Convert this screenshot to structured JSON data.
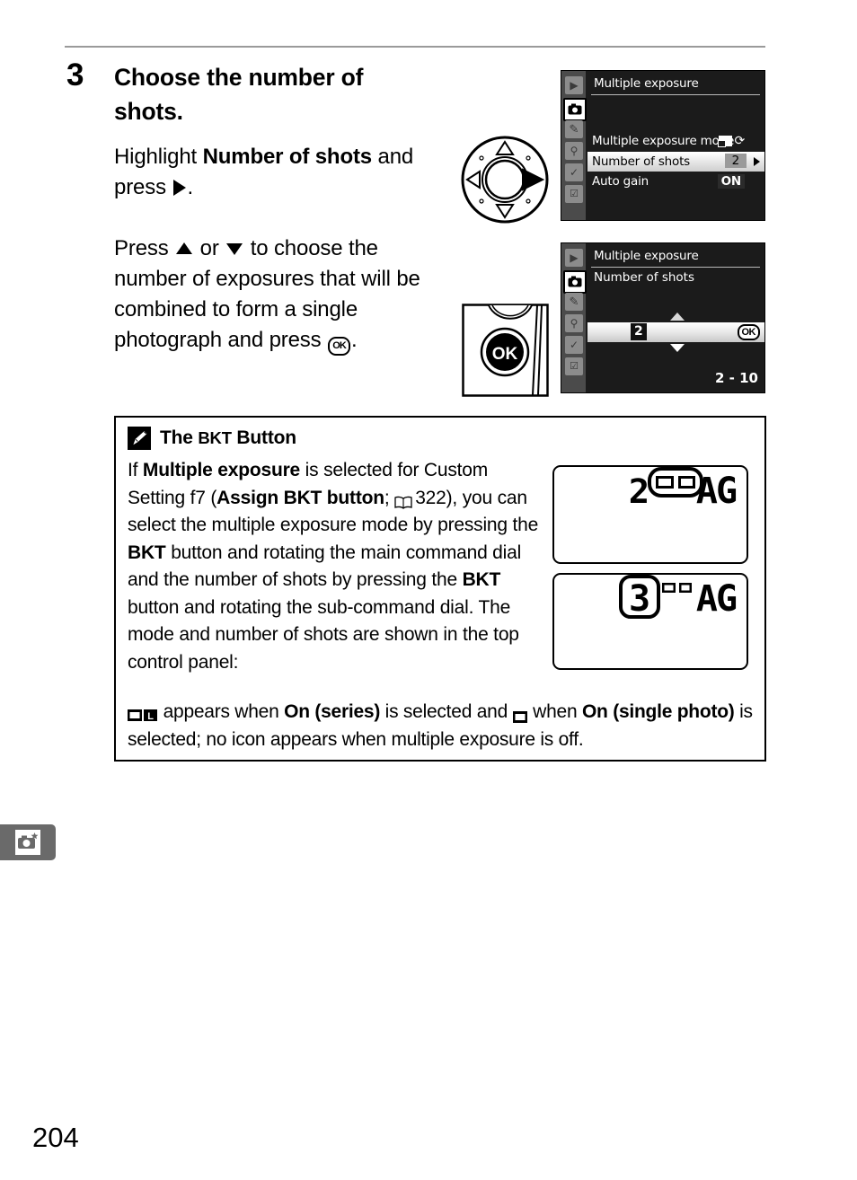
{
  "page": {
    "number": "204",
    "chapter_tab_icon": "camera-star-icon"
  },
  "step": {
    "number": "3",
    "title": "Choose the number of shots.",
    "paragraph_1_pre": "Highlight ",
    "paragraph_1_bold": "Number of shots",
    "paragraph_1_mid": " and press ",
    "paragraph_1_post": ".",
    "paragraph_2_a": "Press ",
    "paragraph_2_b": " or ",
    "paragraph_2_c": " to choose the number of exposures that will be combined to form a single photograph and press ",
    "paragraph_2_d": "."
  },
  "diagrams": {
    "multi_selector_name": "multi-selector-right",
    "ok_button_label": "OK"
  },
  "lcd_menu_1": {
    "title": "Multiple exposure",
    "sidebar_icons": [
      "playback-icon",
      "shooting-menu-icon",
      "custom-setting-icon",
      "setup-icon",
      "retouch-icon",
      "recent-settings-icon"
    ],
    "active_sidebar_index": 1,
    "rows": [
      {
        "label": "Multiple exposure mode",
        "value": "",
        "value_type": "icons",
        "selected": false
      },
      {
        "label": "Number of shots",
        "value": "2",
        "value_type": "text",
        "selected": true
      },
      {
        "label": "Auto gain",
        "value": "ON",
        "value_type": "box",
        "selected": false
      }
    ]
  },
  "lcd_menu_2": {
    "title": "Multiple exposure",
    "subtitle": "Number of shots",
    "value": "2",
    "ok_label": "OK",
    "range": "2 - 10"
  },
  "note": {
    "icon": "pencil-icon",
    "title_lead": "The ",
    "title_bkt": "BKT",
    "title_tail": " Button",
    "body_1": "If ",
    "body_b1": "Multiple exposure",
    "body_2": " is selected for Custom Setting f7 (",
    "body_b2": "Assign BKT button",
    "body_3": "; ",
    "body_page_ref": "322",
    "body_4": "), you can select the multiple exposure mode by pressing the ",
    "body_b3": "BKT",
    "body_5": " button and rotating the main command dial and the number of shots by pressing the ",
    "body_b4": "BKT",
    "body_6": " button and rotating the sub-command dial. The mode and number of shots are shown in the top control panel:",
    "tail_1": " appears when ",
    "tail_b1": "On (series)",
    "tail_2": " is selected and ",
    "tail_3": " when ",
    "tail_b2": "On (single photo)",
    "tail_4": " is selected; no icon appears when multiple exposure is off."
  },
  "control_panel_1": {
    "digit": "2",
    "suffix": "AG",
    "highlight": "mode-icons",
    "icons": [
      "multi-frame-filled-icon",
      "single-frame-icon"
    ]
  },
  "control_panel_2": {
    "digit": "3",
    "suffix": "AG",
    "highlight": "digit",
    "icons": [
      "multi-frame-filled-icon",
      "single-frame-icon"
    ]
  }
}
